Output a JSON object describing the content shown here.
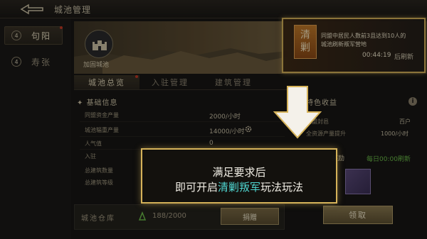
{
  "header": {
    "title": "城池管理"
  },
  "sidebar": {
    "items": [
      {
        "num": "4",
        "label": "句阳"
      },
      {
        "num": "4",
        "label": "寿张"
      }
    ]
  },
  "banner": {
    "fort_label": "加固城池",
    "notice": {
      "badge": "清剿",
      "line1": "同盟中居民人数前3且达到10人的",
      "line2": "城池刷新叛军营地",
      "timer": "00:44:19",
      "refresh": "后刷新"
    }
  },
  "tabs": [
    "城池总览",
    "入驻管理",
    "建筑管理"
  ],
  "basic_info": {
    "title": "基础信息",
    "rows": [
      {
        "label": "同盟资金产量",
        "value": "2000/小时"
      },
      {
        "label": "城池辎重产量",
        "value": "14000/小时"
      },
      {
        "label": "人气值",
        "value": "0"
      },
      {
        "label": "入驻",
        "value": ""
      },
      {
        "label": "总建筑数量",
        "value": ""
      },
      {
        "label": "总建筑等级",
        "value": ""
      }
    ]
  },
  "income": {
    "title": "特色收益",
    "row1": {
      "label": "同盟封邑",
      "value": "百户"
    },
    "row2": {
      "label": "全资源产量提升",
      "value": "1000/小时"
    },
    "reward_label": "奖励",
    "reward_refresh": "每日00:00刷新",
    "claim": "领取"
  },
  "warehouse": {
    "label": "城池仓库",
    "value": "188/2000",
    "donate": "捐赠"
  },
  "prompt": {
    "line1": "满足要求后",
    "line2_pre": "即可开启",
    "line2_hl": "清剿叛军",
    "line2_post": "玩法玩法"
  },
  "colors": {
    "gold_frame": "#d6b35a",
    "highlight": "#4fd5d0",
    "green_text": "#6dbf4a",
    "badge_dot": "#c23a26"
  }
}
